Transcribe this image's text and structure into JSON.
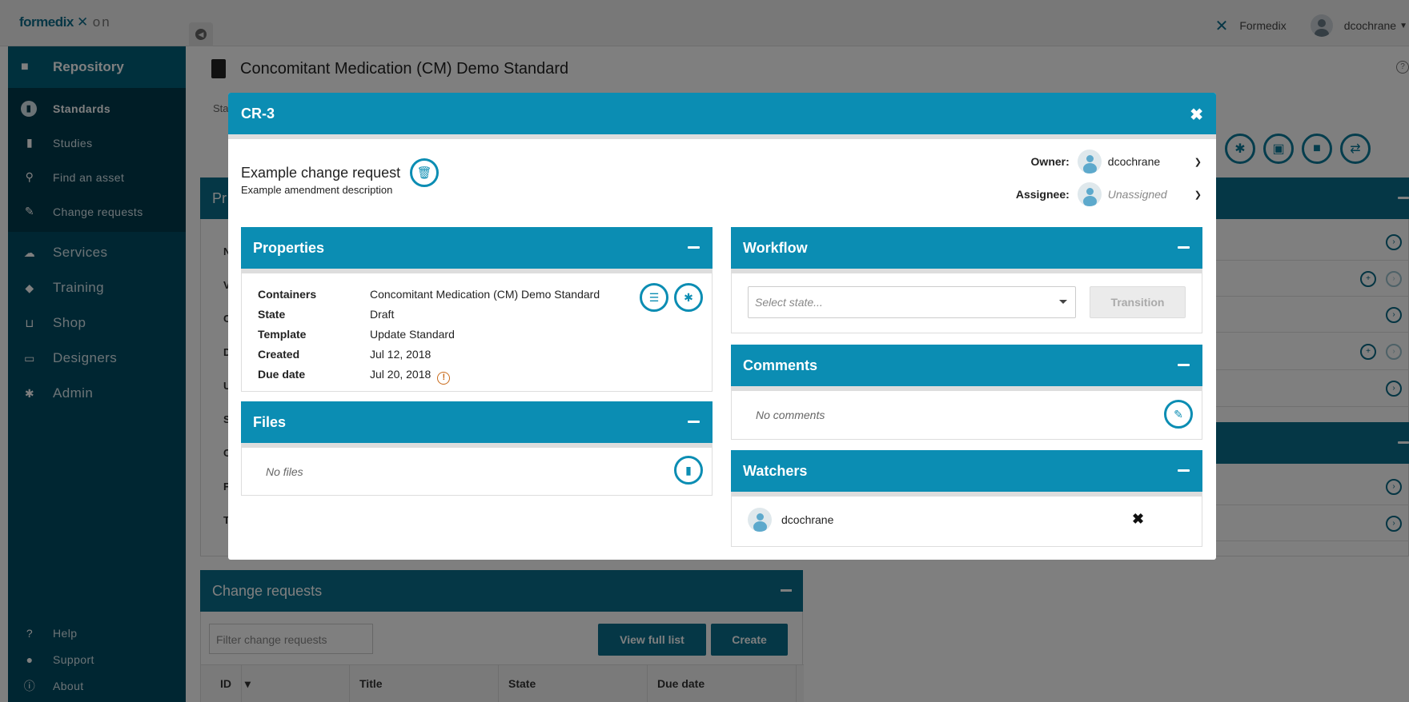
{
  "app": {
    "logo_main": "formedix",
    "logo_suffix": "on",
    "org_name": "Formedix",
    "user_name": "dcochrane"
  },
  "sidebar": {
    "section": "Repository",
    "sub_items": [
      {
        "label": "Standards",
        "icon": "book-icon"
      },
      {
        "label": "Studies",
        "icon": "clipboard-icon"
      },
      {
        "label": "Find an asset",
        "icon": "search-icon"
      },
      {
        "label": "Change requests",
        "icon": "pencil-icon"
      }
    ],
    "main_items": [
      {
        "label": "Services",
        "icon": "cloud-icon"
      },
      {
        "label": "Training",
        "icon": "graduation-cap-icon"
      },
      {
        "label": "Shop",
        "icon": "cart-icon"
      },
      {
        "label": "Designers",
        "icon": "monitor-icon"
      },
      {
        "label": "Admin",
        "icon": "gear-icon"
      }
    ],
    "bottom_items": [
      {
        "label": "Help",
        "icon": "question-icon"
      },
      {
        "label": "Support",
        "icon": "chat-icon"
      },
      {
        "label": "About",
        "icon": "info-icon"
      }
    ]
  },
  "page": {
    "title": "Concomitant Medication (CM) Demo Standard",
    "breadcrumb_fragment": "Sta",
    "properties_fragment": "Pr",
    "row_letters": [
      "N",
      "V",
      "C",
      "D",
      "U",
      "S",
      "C",
      "F",
      "T"
    ]
  },
  "change_requests_panel": {
    "title": "Change requests",
    "filter_placeholder": "Filter change requests",
    "view_full_list": "View full list",
    "create": "Create",
    "columns": [
      "ID",
      "Title",
      "State",
      "Due date"
    ]
  },
  "modal": {
    "id": "CR-3",
    "title": "Example change request",
    "description": "Example amendment description",
    "owner_label": "Owner:",
    "owner_value": "dcochrane",
    "assignee_label": "Assignee:",
    "assignee_value": "Unassigned",
    "properties": {
      "title": "Properties",
      "rows": [
        {
          "key": "Containers",
          "value": "Concomitant Medication (CM) Demo Standard"
        },
        {
          "key": "State",
          "value": "Draft"
        },
        {
          "key": "Template",
          "value": "Update Standard"
        },
        {
          "key": "Created",
          "value": "Jul 12, 2018"
        },
        {
          "key": "Due date",
          "value": "Jul 20, 2018"
        }
      ]
    },
    "files": {
      "title": "Files",
      "empty": "No files"
    },
    "workflow": {
      "title": "Workflow",
      "select_placeholder": "Select state...",
      "transition_label": "Transition"
    },
    "comments": {
      "title": "Comments",
      "empty": "No comments"
    },
    "watchers": {
      "title": "Watchers",
      "items": [
        "dcochrane"
      ]
    }
  },
  "colors": {
    "accent": "#0b8db3",
    "sidebar": "#004c64",
    "sidebar_active": "#003a4d",
    "warning": "#c96a1a"
  }
}
